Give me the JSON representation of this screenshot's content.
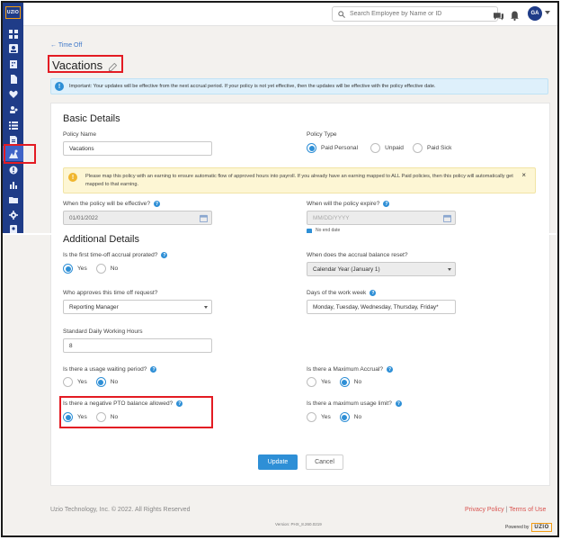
{
  "brand": {
    "logo_text": "UZIO",
    "accent": "#1f3c88",
    "primary": "#2e8fd6"
  },
  "header": {
    "search_placeholder": "Search Employee by Name or ID",
    "avatar_initials": "GA"
  },
  "sidebar": {
    "items": [
      {
        "icon": "dashboard-icon"
      },
      {
        "icon": "person-card-icon"
      },
      {
        "icon": "building-icon"
      },
      {
        "icon": "document-icon"
      },
      {
        "icon": "heart-icon"
      },
      {
        "icon": "team-icon"
      },
      {
        "icon": "list-icon"
      },
      {
        "icon": "file-icon"
      },
      {
        "icon": "time-off-icon",
        "active": true
      },
      {
        "icon": "clock-alert-icon"
      },
      {
        "icon": "bar-chart-icon"
      },
      {
        "icon": "folder-icon"
      },
      {
        "icon": "gear-icon"
      },
      {
        "icon": "id-badge-icon"
      }
    ]
  },
  "page": {
    "back_label": "← Time Off",
    "title": "Vacations",
    "notice": "Important: Your updates will be effective from the next accrual period. If your policy is not yet effective, then the updates will be effective with the policy effective date."
  },
  "basic": {
    "heading": "Basic Details",
    "policy_name_label": "Policy Name",
    "policy_name_value": "Vacations",
    "policy_type_label": "Policy Type",
    "policy_type_options": [
      "Paid Personal",
      "Unpaid",
      "Paid Sick"
    ],
    "warning": "Please map this policy with an earning to ensure automatic flow of approved hours into payroll. If you already have an earning mapped to ALL Paid policies, then this policy will automatically get mapped to that earning.",
    "warning_close": "×",
    "effective_label": "When the policy will be effective?",
    "effective_value": "01/01/2022",
    "expire_label": "When will the policy expire?",
    "expire_placeholder": "MM/DD/YYYY",
    "no_end_date_label": "No end date"
  },
  "additional": {
    "heading": "Additional Details",
    "prorated_label": "Is the first time-off accrual prorated?",
    "reset_label": "When does the accrual balance reset?",
    "reset_value": "Calendar Year (January 1)",
    "approver_label": "Who approves this time off request?",
    "approver_value": "Reporting Manager",
    "work_week_label": "Days of the work week",
    "work_week_value": "Monday, Tuesday, Wednesday, Thursday, Friday*",
    "hours_label": "Standard Daily Working Hours",
    "hours_value": "8",
    "waiting_label": "Is there a usage waiting period?",
    "max_accrual_label": "Is there a Maximum Accrual?",
    "negative_label": "Is there a negative PTO balance allowed?",
    "max_usage_label": "Is there a maximum usage limit?",
    "yes": "Yes",
    "no": "No"
  },
  "actions": {
    "update": "Update",
    "cancel": "Cancel"
  },
  "footer": {
    "copyright": "Uzio Technology, Inc. © 2022. All Rights Reserved",
    "privacy": "Privacy Policy",
    "separator": "|",
    "terms": "Terms of Use",
    "version": "Version: PHX_8.260.0219",
    "powered_by": "Powered by"
  }
}
